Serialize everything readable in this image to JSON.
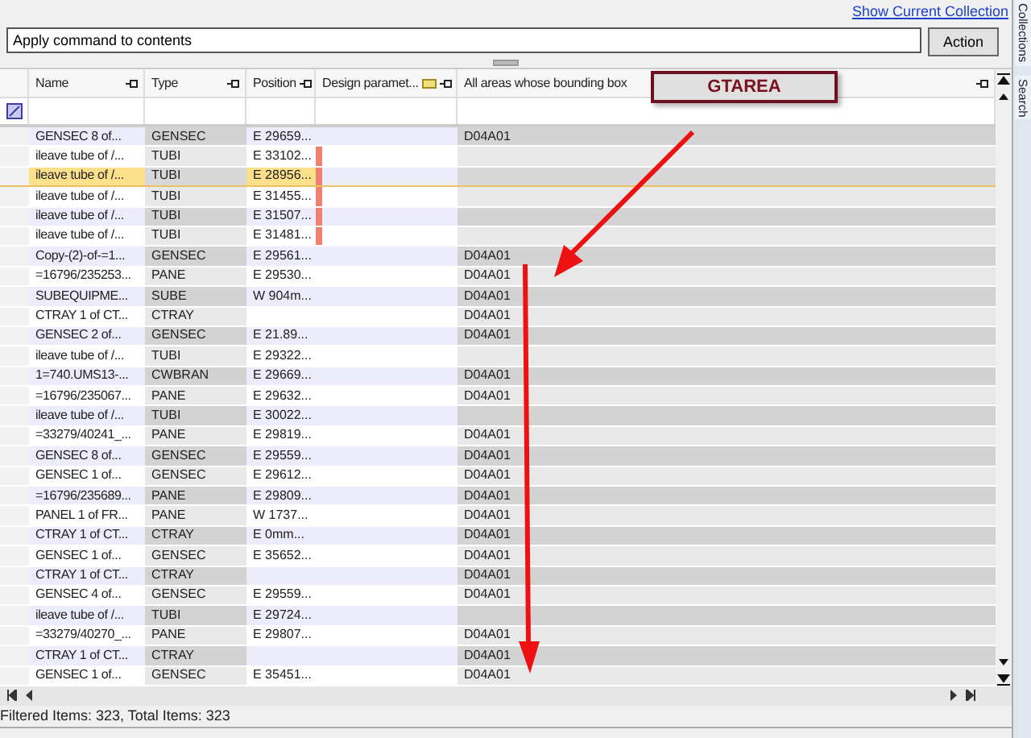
{
  "link": "Show Current Collection",
  "command": {
    "value": "Apply command to contents",
    "button": "Action"
  },
  "columns": [
    "Name",
    "Type",
    "Position",
    "Design  paramet...",
    "All areas  whose bounding box"
  ],
  "callout": "GTAREA",
  "rows": [
    {
      "name": "GENSEC 8 of...",
      "type": "GENSEC",
      "position": "E 29659...",
      "marker": false,
      "area": "D04A01",
      "selected": false
    },
    {
      "name": "ileave tube of /...",
      "type": "TUBI",
      "position": "E 33102...",
      "marker": true,
      "area": "",
      "selected": false
    },
    {
      "name": "ileave tube of /...",
      "type": "TUBI",
      "position": "E 28956...",
      "marker": true,
      "area": "",
      "selected": true
    },
    {
      "name": "ileave tube of /...",
      "type": "TUBI",
      "position": "E 31455...",
      "marker": true,
      "area": "",
      "selected": false
    },
    {
      "name": "ileave tube of /...",
      "type": "TUBI",
      "position": "E 31507...",
      "marker": true,
      "area": "",
      "selected": false
    },
    {
      "name": "ileave tube of /...",
      "type": "TUBI",
      "position": "E 31481...",
      "marker": true,
      "area": "",
      "selected": false
    },
    {
      "name": "Copy-(2)-of-=1...",
      "type": "GENSEC",
      "position": "E 29561...",
      "marker": false,
      "area": "D04A01",
      "selected": false
    },
    {
      "name": "=16796/235253...",
      "type": "PANE",
      "position": "E 29530...",
      "marker": false,
      "area": "D04A01",
      "selected": false
    },
    {
      "name": "SUBEQUIPME...",
      "type": "SUBE",
      "position": "W 904m...",
      "marker": false,
      "area": "D04A01",
      "selected": false
    },
    {
      "name": "CTRAY 1 of CT...",
      "type": "CTRAY",
      "position": "",
      "marker": false,
      "area": "D04A01",
      "selected": false
    },
    {
      "name": "GENSEC 2 of...",
      "type": "GENSEC",
      "position": "E 21.89...",
      "marker": false,
      "area": "D04A01",
      "selected": false
    },
    {
      "name": "ileave tube of /...",
      "type": "TUBI",
      "position": "E 29322...",
      "marker": false,
      "area": "",
      "selected": false
    },
    {
      "name": "1=740.UMS13-...",
      "type": "CWBRAN",
      "position": "E 29669...",
      "marker": false,
      "area": "D04A01",
      "selected": false
    },
    {
      "name": "=16796/235067...",
      "type": "PANE",
      "position": "E 29632...",
      "marker": false,
      "area": "D04A01",
      "selected": false
    },
    {
      "name": "ileave tube of /...",
      "type": "TUBI",
      "position": "E 30022...",
      "marker": false,
      "area": "",
      "selected": false
    },
    {
      "name": "=33279/40241_...",
      "type": "PANE",
      "position": "E 29819...",
      "marker": false,
      "area": "D04A01",
      "selected": false
    },
    {
      "name": "GENSEC 8 of...",
      "type": "GENSEC",
      "position": "E 29559...",
      "marker": false,
      "area": "D04A01",
      "selected": false
    },
    {
      "name": "GENSEC 1 of...",
      "type": "GENSEC",
      "position": "E 29612...",
      "marker": false,
      "area": "D04A01",
      "selected": false
    },
    {
      "name": "=16796/235689...",
      "type": "PANE",
      "position": "E 29809...",
      "marker": false,
      "area": "D04A01",
      "selected": false
    },
    {
      "name": "PANEL 1 of FR...",
      "type": "PANE",
      "position": "W 1737...",
      "marker": false,
      "area": "D04A01",
      "selected": false
    },
    {
      "name": "CTRAY 1 of CT...",
      "type": "CTRAY",
      "position": "E 0mm...",
      "marker": false,
      "area": "D04A01",
      "selected": false
    },
    {
      "name": "GENSEC 1 of...",
      "type": "GENSEC",
      "position": "E 35652...",
      "marker": false,
      "area": "D04A01",
      "selected": false
    },
    {
      "name": "CTRAY 1 of CT...",
      "type": "CTRAY",
      "position": "",
      "marker": false,
      "area": "D04A01",
      "selected": false
    },
    {
      "name": "GENSEC 4 of...",
      "type": "GENSEC",
      "position": "E 29559...",
      "marker": false,
      "area": "D04A01",
      "selected": false
    },
    {
      "name": "ileave tube of /...",
      "type": "TUBI",
      "position": "E 29724...",
      "marker": false,
      "area": "",
      "selected": false
    },
    {
      "name": "=33279/40270_...",
      "type": "PANE",
      "position": "E 29807...",
      "marker": false,
      "area": "D04A01",
      "selected": false
    },
    {
      "name": "CTRAY 1 of CT...",
      "type": "CTRAY",
      "position": "",
      "marker": false,
      "area": "D04A01",
      "selected": false
    },
    {
      "name": "GENSEC 1 of...",
      "type": "GENSEC",
      "position": "E 35451...",
      "marker": false,
      "area": "D04A01",
      "selected": false
    }
  ],
  "status": "Filtered Items: 323, Total Items: 323",
  "side_tabs": [
    "Collections",
    "Search"
  ]
}
